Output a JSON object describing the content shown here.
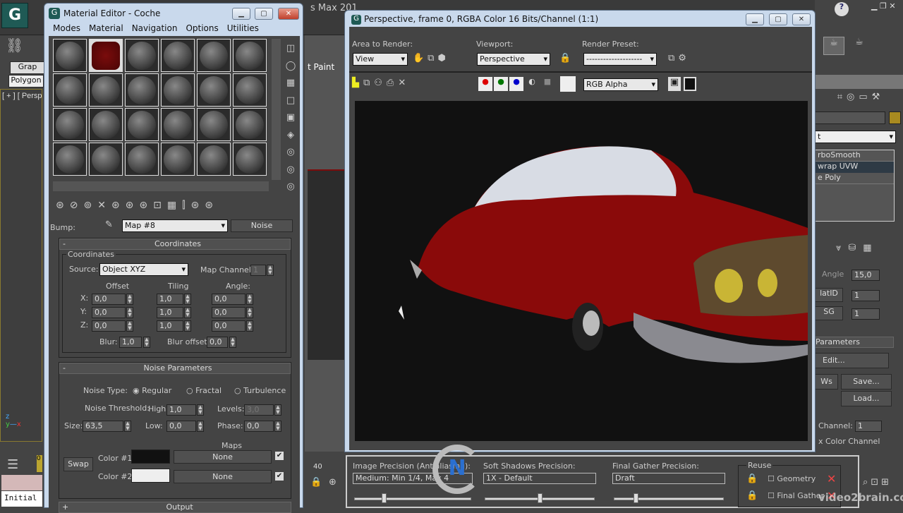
{
  "app": {
    "title_fragment": "s Max 201",
    "help": "?",
    "viewport_label": "[ + ] [ Persp",
    "graphite": "Grap",
    "polygon": "Polygon",
    "paint": "t Paint",
    "initial": "Initial",
    "frame_zero": "0",
    "timeline_40": "40"
  },
  "material_editor": {
    "title": "Material Editor - Coche",
    "menu": [
      "Modes",
      "Material",
      "Navigation",
      "Options",
      "Utilities"
    ],
    "selected_slot": 2,
    "bump_label": "Bump:",
    "map_name": "Map #8",
    "map_type": "Noise",
    "coordinates": {
      "header": "Coordinates",
      "group": "Coordinates",
      "source_label": "Source:",
      "source": "Object XYZ",
      "map_channel_label": "Map Channel:",
      "map_channel": "1",
      "offset_label": "Offset",
      "tiling_label": "Tiling",
      "angle_label": "Angle:",
      "rows": [
        {
          "axis": "X:",
          "offset": "0,0",
          "tiling": "1,0",
          "angle": "0,0"
        },
        {
          "axis": "Y:",
          "offset": "0,0",
          "tiling": "1,0",
          "angle": "0,0"
        },
        {
          "axis": "Z:",
          "offset": "0,0",
          "tiling": "1,0",
          "angle": "0,0"
        }
      ],
      "blur_label": "Blur:",
      "blur": "1,0",
      "blur_offset_label": "Blur offset:",
      "blur_offset": "0,0"
    },
    "noise": {
      "header": "Noise Parameters",
      "type_label": "Noise Type:",
      "types": [
        "Regular",
        "Fractal",
        "Turbulence"
      ],
      "selected_type": "Regular",
      "threshold_label": "Noise Threshold:",
      "high_label": "High:",
      "high": "1,0",
      "levels_label": "Levels:",
      "levels": "3,0",
      "size_label": "Size:",
      "size": "63,5",
      "low_label": "Low:",
      "low": "0,0",
      "phase_label": "Phase:",
      "phase": "0,0",
      "maps_label": "Maps",
      "swap": "Swap",
      "color1_label": "Color #1",
      "color1": "#111111",
      "color2_label": "Color #2",
      "color2": "#eeeeee",
      "map1": "None",
      "map2": "None"
    },
    "output_header": "Output"
  },
  "render_window": {
    "title": "Perspective, frame 0, RGBA Color 16 Bits/Channel (1:1)",
    "area_label": "Area to Render:",
    "area": "View",
    "viewport_label": "Viewport:",
    "viewport": "Perspective",
    "preset_label": "Render Preset:",
    "preset": "--------------------",
    "channel": "RGB Alpha",
    "image_precision_label": "Image Precision (Antialiasing):",
    "image_precision": "Medium: Min 1/4, Max 4",
    "soft_shadows_label": "Soft Shadows Precision:",
    "soft_shadows": "1X - Default",
    "final_gather_label": "Final Gather Precision:",
    "final_gather": "Draft",
    "reuse_label": "Reuse",
    "geometry": "Geometry",
    "final_gather_reuse": "Final Gather",
    "sliders": {
      "image_precision": 0.25,
      "soft_shadows": 0.5,
      "final_gather": 0.2
    }
  },
  "command_panel": {
    "modifiers": [
      "rboSmooth",
      "wrap UVW",
      "e Poly"
    ],
    "selected_modifier": 1,
    "angle": "Angle",
    "angle_value": "15,0",
    "matid": "latID",
    "sg": "SG",
    "matid_value": "1",
    "sg_value": "1",
    "params": "Parameters",
    "edit": "Edit...",
    "ws": "Ws",
    "save": "Save...",
    "load": "Load...",
    "channel_label": "Channel:",
    "channel": "1",
    "color_channel": "x Color Channel",
    "object_color": "#a88a20"
  },
  "watermark": "video2brain.com"
}
